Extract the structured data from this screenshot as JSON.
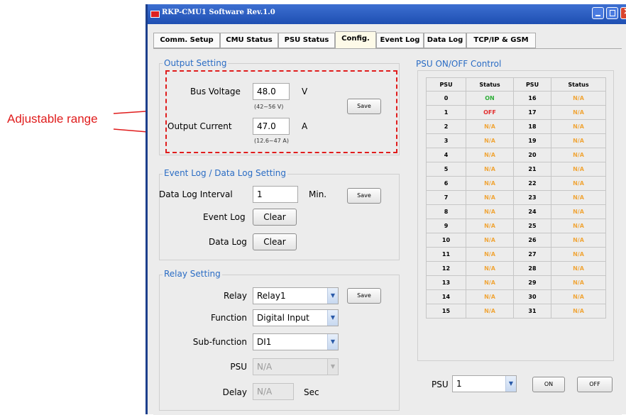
{
  "annotation": {
    "text": "Adjustable range",
    "color": "#e01c1c"
  },
  "window": {
    "title": "RKP-CMU1 Software  Rev.1.0"
  },
  "tabs": [
    {
      "label": "Comm. Setup",
      "active": false
    },
    {
      "label": "CMU Status",
      "active": false
    },
    {
      "label": "PSU Status",
      "active": false
    },
    {
      "label": "Config.",
      "active": true
    },
    {
      "label": "Event Log",
      "active": false
    },
    {
      "label": "Data Log",
      "active": false
    },
    {
      "label": "TCP/IP & GSM",
      "active": false
    }
  ],
  "output_setting": {
    "title": "Output Setting",
    "bus_voltage_label": "Bus Voltage",
    "bus_voltage_value": "48.0",
    "bus_voltage_unit": "V",
    "bus_voltage_range": "(42~56 V)",
    "output_current_label": "Output Current",
    "output_current_value": "47.0",
    "output_current_unit": "A",
    "output_current_range": "(12.6~47 A)",
    "save_label": "Save"
  },
  "log_setting": {
    "title": "Event Log / Data Log Setting",
    "data_log_interval_label": "Data Log Interval",
    "data_log_interval_value": "1",
    "interval_unit": "Min.",
    "save_label": "Save",
    "event_log_label": "Event Log",
    "event_log_clear": "Clear",
    "data_log_label": "Data Log",
    "data_log_clear": "Clear"
  },
  "relay_setting": {
    "title": "Relay Setting",
    "relay_label": "Relay",
    "relay_value": "Relay1",
    "save_label": "Save",
    "function_label": "Function",
    "function_value": "Digital Input",
    "subfunction_label": "Sub-function",
    "subfunction_value": "DI1",
    "psu_label": "PSU",
    "psu_value": "N/A",
    "delay_label": "Delay",
    "delay_value": "N/A",
    "delay_unit": "Sec"
  },
  "psu_control": {
    "title": "PSU ON/OFF Control",
    "headers": [
      "PSU",
      "Status",
      "PSU",
      "Status"
    ],
    "rows": [
      [
        "0",
        "ON",
        "16",
        "N/A"
      ],
      [
        "1",
        "OFF",
        "17",
        "N/A"
      ],
      [
        "2",
        "N/A",
        "18",
        "N/A"
      ],
      [
        "3",
        "N/A",
        "19",
        "N/A"
      ],
      [
        "4",
        "N/A",
        "20",
        "N/A"
      ],
      [
        "5",
        "N/A",
        "21",
        "N/A"
      ],
      [
        "6",
        "N/A",
        "22",
        "N/A"
      ],
      [
        "7",
        "N/A",
        "23",
        "N/A"
      ],
      [
        "8",
        "N/A",
        "24",
        "N/A"
      ],
      [
        "9",
        "N/A",
        "25",
        "N/A"
      ],
      [
        "10",
        "N/A",
        "26",
        "N/A"
      ],
      [
        "11",
        "N/A",
        "27",
        "N/A"
      ],
      [
        "12",
        "N/A",
        "28",
        "N/A"
      ],
      [
        "13",
        "N/A",
        "29",
        "N/A"
      ],
      [
        "14",
        "N/A",
        "30",
        "N/A"
      ],
      [
        "15",
        "N/A",
        "31",
        "N/A"
      ]
    ],
    "psu_select_label": "PSU",
    "psu_select_value": "1",
    "on_label": "ON",
    "off_label": "OFF"
  }
}
